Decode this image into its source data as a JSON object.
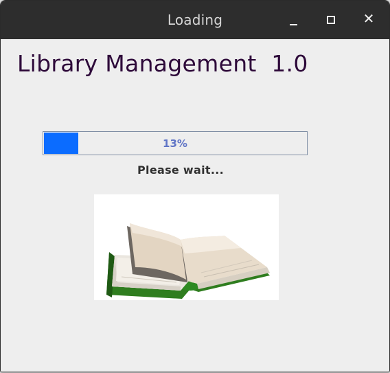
{
  "window": {
    "title": "Loading",
    "controls": {
      "minimize": "minimize-icon",
      "maximize": "maximize-icon",
      "close": "close-icon",
      "close_glyph": "✕"
    }
  },
  "main": {
    "app_title": "Library Management  1.0",
    "progress": {
      "value_percent": 13,
      "label": "13%",
      "fill_color": "#0b6cff",
      "label_color": "#5f74c6"
    },
    "status_text": "Please wait...",
    "image": {
      "icon": "open-book-icon"
    }
  },
  "colors": {
    "titlebar": "#2d2d2d",
    "window_bg": "#eeeeee",
    "title_text": "#2e0a3a"
  }
}
